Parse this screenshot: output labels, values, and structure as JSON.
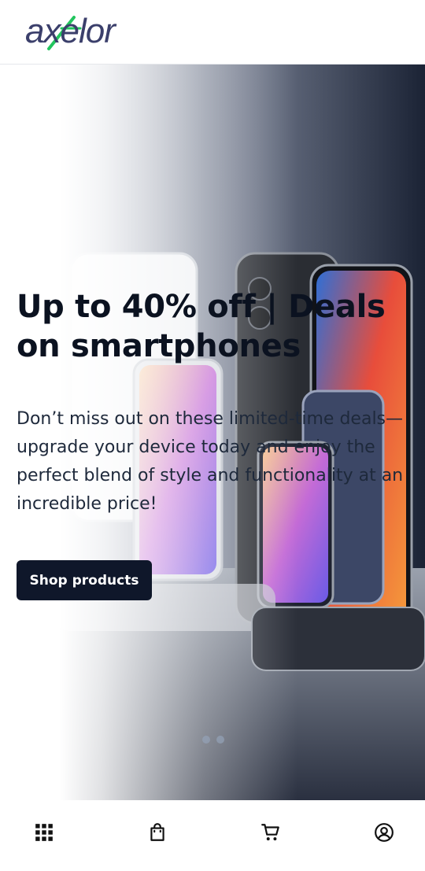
{
  "header": {
    "logo_text": "axelor"
  },
  "hero": {
    "title": "Up to 40% off | Deals on smartphones",
    "description": "Don’t miss out on these limited-time deals—upgrade your device today and enjoy the perfect blend of style and functionality at an incredible price!",
    "cta_label": "Shop products",
    "slide_count": 2
  },
  "bottom_nav": {
    "items": [
      {
        "icon": "grid-icon"
      },
      {
        "icon": "shopping-bag-icon"
      },
      {
        "icon": "cart-icon"
      },
      {
        "icon": "account-icon"
      }
    ]
  },
  "colors": {
    "primary": "#0f172a",
    "logo_text": "#3b3f6b",
    "logo_accent": "#22c55e"
  }
}
